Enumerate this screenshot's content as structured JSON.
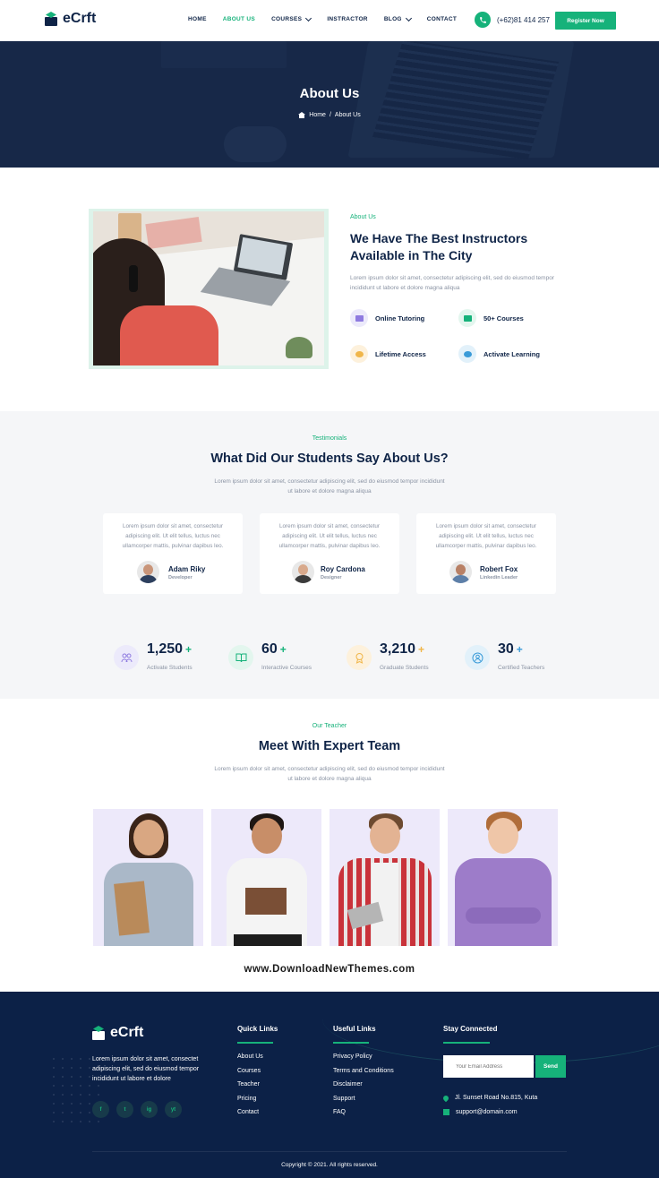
{
  "header": {
    "logo_text": "eCrft",
    "nav": [
      {
        "label": "HOME",
        "active": false,
        "dropdown": false
      },
      {
        "label": "ABOUT US",
        "active": true,
        "dropdown": false
      },
      {
        "label": "COURSES",
        "active": false,
        "dropdown": true
      },
      {
        "label": "INSTRACTOR",
        "active": false,
        "dropdown": false
      },
      {
        "label": "BLOG",
        "active": false,
        "dropdown": true
      },
      {
        "label": "CONTACT",
        "active": false,
        "dropdown": false
      }
    ],
    "phone": "(+62)81 414 257",
    "register_label": "Register Now"
  },
  "hero": {
    "title": "About Us",
    "breadcrumb_home": "Home",
    "breadcrumb_sep": "/",
    "breadcrumb_current": "About Us"
  },
  "about": {
    "subtitle": "About Us",
    "title": "We Have The Best Instructors Available in The City",
    "description": "Lorem ipsum dolor sit amet, consectetur adipiscing elit, sed do eiusmod tempor incididunt ut labore et dolore magna aliqua",
    "features": [
      {
        "label": "Online Tutoring",
        "icon": "monitor-icon"
      },
      {
        "label": "50+ Courses",
        "icon": "book-icon"
      },
      {
        "label": "Lifetime Access",
        "icon": "users-icon"
      },
      {
        "label": "Activate Learning",
        "icon": "people-icon"
      }
    ]
  },
  "testimonials": {
    "subtitle": "Testimonials",
    "title": "What Did Our Students Say About Us?",
    "description": "Lorem ipsum dolor sit amet, consectetur adipiscing elit, sed do eiusmod tempor incididunt ut labore et dolore magna aliqua",
    "items": [
      {
        "text": "Lorem ipsum dolor sit amet, consectetur adipiscing elit. Ut elit tellus, luctus nec ullamcorper mattis, pulvinar dapibus leo.",
        "name": "Adam Riky",
        "role": "Developer"
      },
      {
        "text": "Lorem ipsum dolor sit amet, consectetur adipiscing elit. Ut elit tellus, luctus nec ullamcorper mattis, pulvinar dapibus leo.",
        "name": "Roy Cardona",
        "role": "Designer"
      },
      {
        "text": "Lorem ipsum dolor sit amet, consectetur adipiscing elit. Ut elit tellus, luctus nec ullamcorper mattis, pulvinar dapibus leo.",
        "name": "Robert Fox",
        "role": "Linkedin Leader"
      }
    ]
  },
  "stats": [
    {
      "number": "1,250",
      "plus": "+",
      "label": "Activate Students",
      "icon": "students-icon",
      "color": "#8f7be0"
    },
    {
      "number": "60",
      "plus": "+",
      "label": "Interactive Courses",
      "icon": "open-book-icon",
      "color": "#16b27a"
    },
    {
      "number": "3,210",
      "plus": "+",
      "label": "Graduate Students",
      "icon": "award-icon",
      "color": "#f0b64a"
    },
    {
      "number": "30",
      "plus": "+",
      "label": "Certified Teachers",
      "icon": "teacher-icon",
      "color": "#3a9bd8"
    }
  ],
  "team": {
    "subtitle": "Our Teacher",
    "title": "Meet With Expert Team",
    "description": "Lorem ipsum dolor sit amet, consectetur adipiscing elit, sed do eiusmod tempor incididunt ut labore et dolore magna aliqua"
  },
  "watermark": "www.DownloadNewThemes.com",
  "footer": {
    "logo_text": "eCrft",
    "description": "Lorem ipsum dolor sit amet, consectet adipiscing elit, sed do eiusmod tempor incididunt ut labore et dolore",
    "socials": [
      "f",
      "t",
      "ig",
      "yt"
    ],
    "quick_links_title": "Quick Links",
    "quick_links": [
      "About Us",
      "Courses",
      "Teacher",
      "Pricing",
      "Contact"
    ],
    "useful_links_title": "Useful Links",
    "useful_links": [
      "Privacy Policy",
      "Terms and Conditions",
      "Disclaimer",
      "Support",
      "FAQ"
    ],
    "stay_title": "Stay Connected",
    "email_placeholder": "Your Email Address",
    "send_label": "Send",
    "address": "Jl. Sunset Road No.815, Kuta",
    "email": "support@domain.com",
    "copyright": "Copyright © 2021. All rights reserved."
  },
  "colors": {
    "accent": "#16b27a",
    "navy": "#0f2447",
    "footer_bg": "#0c2147"
  }
}
